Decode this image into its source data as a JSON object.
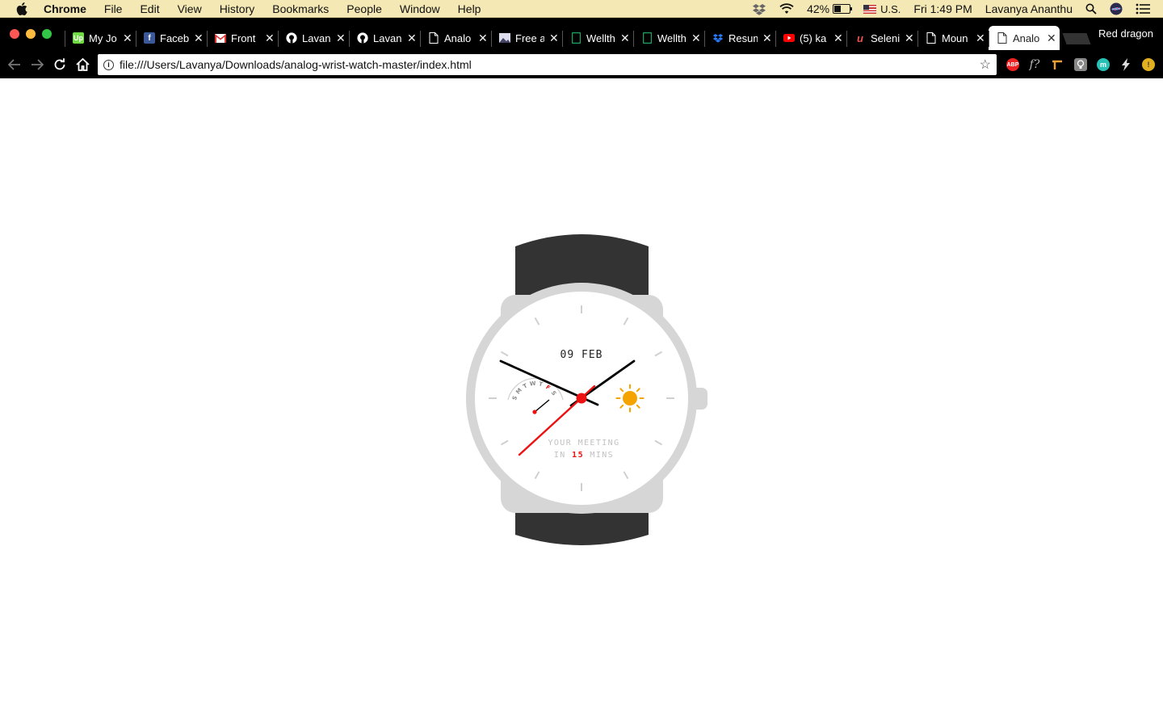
{
  "menubar": {
    "apple_icon": "apple-icon",
    "items": [
      "Chrome",
      "File",
      "Edit",
      "View",
      "History",
      "Bookmarks",
      "People",
      "Window",
      "Help"
    ],
    "battery_percent": "42%",
    "battery_level": 0.42,
    "input_source": "U.S.",
    "clock": "Fri 1:49 PM",
    "user_name": "Lavanya Ananthu"
  },
  "browser": {
    "profile_name": "Red dragon",
    "tabs": [
      {
        "label": "My Jo",
        "icon": "upwork-icon"
      },
      {
        "label": "Faceb",
        "icon": "facebook-icon"
      },
      {
        "label": "Front",
        "icon": "gmail-icon"
      },
      {
        "label": "Lavan",
        "icon": "github-icon"
      },
      {
        "label": "Lavan",
        "icon": "github-icon"
      },
      {
        "label": "Analo",
        "icon": "document-icon"
      },
      {
        "label": "Free a",
        "icon": "image-icon"
      },
      {
        "label": "Wellth",
        "icon": "sheet-icon"
      },
      {
        "label": "Wellth",
        "icon": "sheet-icon"
      },
      {
        "label": "Resum",
        "icon": "dropbox-icon"
      },
      {
        "label": "(5) ka",
        "icon": "youtube-icon"
      },
      {
        "label": "Seleni",
        "icon": "udemy-icon"
      },
      {
        "label": "Moun",
        "icon": "document-icon"
      },
      {
        "label": "Analo",
        "icon": "document-icon",
        "active": true
      }
    ],
    "url": "file:///Users/Lavanya/Downloads/analog-wrist-watch-master/index.html"
  },
  "watch": {
    "date": "09 FEB",
    "days": [
      "S",
      "M",
      "T",
      "W",
      "T",
      "F",
      "S"
    ],
    "active_day": "F",
    "meeting_line1": "YOUR MEETING",
    "meeting_line2_prefix": "IN",
    "meeting_minutes": "15",
    "meeting_line2_suffix": "MINS",
    "time": {
      "hour": 1,
      "minute": 49
    },
    "colors": {
      "strap": "#333333",
      "case": "#d6d6d6",
      "accent": "#ee1111",
      "sun": "#f5a300",
      "hand": "#000000"
    }
  }
}
